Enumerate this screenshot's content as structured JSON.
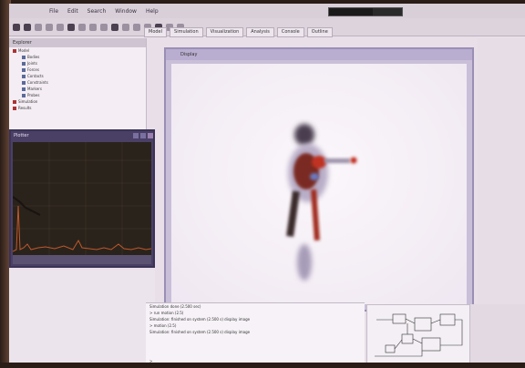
{
  "menubar": {
    "items": [
      "File",
      "Edit",
      "Search",
      "Window",
      "Help"
    ],
    "progress": 0.6
  },
  "tabs": [
    "Model",
    "Simulation",
    "Visualization",
    "Analysis",
    "Console",
    "Outline"
  ],
  "tree": {
    "header": "Explorer",
    "items": [
      {
        "label": "Model",
        "indent": 0,
        "icon": "folder-icon"
      },
      {
        "label": "Bodies",
        "indent": 1,
        "icon": "body-icon"
      },
      {
        "label": "Joints",
        "indent": 1,
        "icon": "joint-icon"
      },
      {
        "label": "Forces",
        "indent": 1,
        "icon": "force-icon"
      },
      {
        "label": "Contacts",
        "indent": 1,
        "icon": "contact-icon"
      },
      {
        "label": "Constraints",
        "indent": 1,
        "icon": "constraint-icon"
      },
      {
        "label": "Markers",
        "indent": 1,
        "icon": "marker-icon"
      },
      {
        "label": "Probes",
        "indent": 1,
        "icon": "probe-icon"
      },
      {
        "label": "Simulation",
        "indent": 0,
        "icon": "folder-icon"
      },
      {
        "label": "Results",
        "indent": 0,
        "icon": "folder-icon"
      }
    ]
  },
  "plot_window": {
    "title": "Plotter"
  },
  "viewer": {
    "title": "Display"
  },
  "console": {
    "lines": [
      "Simulation done (2.500 sec)",
      "> run motion (2.5)",
      "Simulation: finished on system (2.500 s) display image",
      "",
      "> motion (2.5)",
      "Simulation: finished on system (2.500 s) display image"
    ],
    "prompt": ">"
  },
  "colors": {
    "accent": "#4a4066",
    "body": "#b02a1a"
  }
}
